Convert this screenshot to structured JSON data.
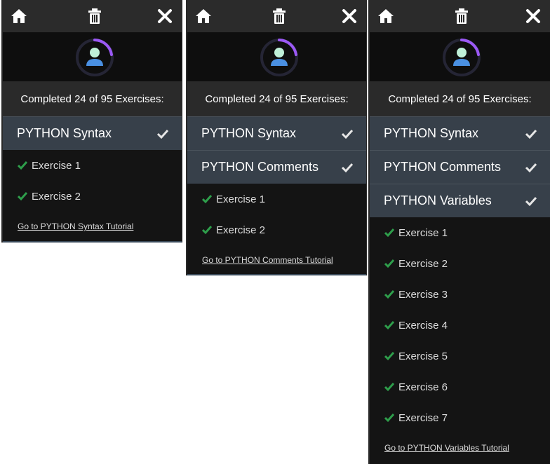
{
  "completed_text": "Completed 24 of 95 Exercises:",
  "colors": {
    "panel_bg": "#141414",
    "topbar": "#2b2b2b",
    "lesson_bg": "#37404a",
    "check_green": "#2e9e4b",
    "progress_ring": "#9b59f5"
  },
  "icons": {
    "home": "home-icon",
    "trash": "trash-icon",
    "close": "close-icon",
    "avatar": "avatar-icon",
    "check": "check-icon"
  },
  "panels": [
    {
      "lessons": [
        "PYTHON Syntax"
      ],
      "exercises": [
        "Exercise 1",
        "Exercise 2"
      ],
      "tutorial_link": "Go to PYTHON Syntax Tutorial"
    },
    {
      "lessons": [
        "PYTHON Syntax",
        "PYTHON Comments"
      ],
      "exercises": [
        "Exercise 1",
        "Exercise 2"
      ],
      "tutorial_link": "Go to PYTHON Comments Tutorial"
    },
    {
      "lessons": [
        "PYTHON Syntax",
        "PYTHON Comments",
        "PYTHON Variables"
      ],
      "exercises": [
        "Exercise 1",
        "Exercise 2",
        "Exercise 3",
        "Exercise 4",
        "Exercise 5",
        "Exercise 6",
        "Exercise 7"
      ],
      "tutorial_link": "Go to PYTHON Variables Tutorial"
    }
  ]
}
